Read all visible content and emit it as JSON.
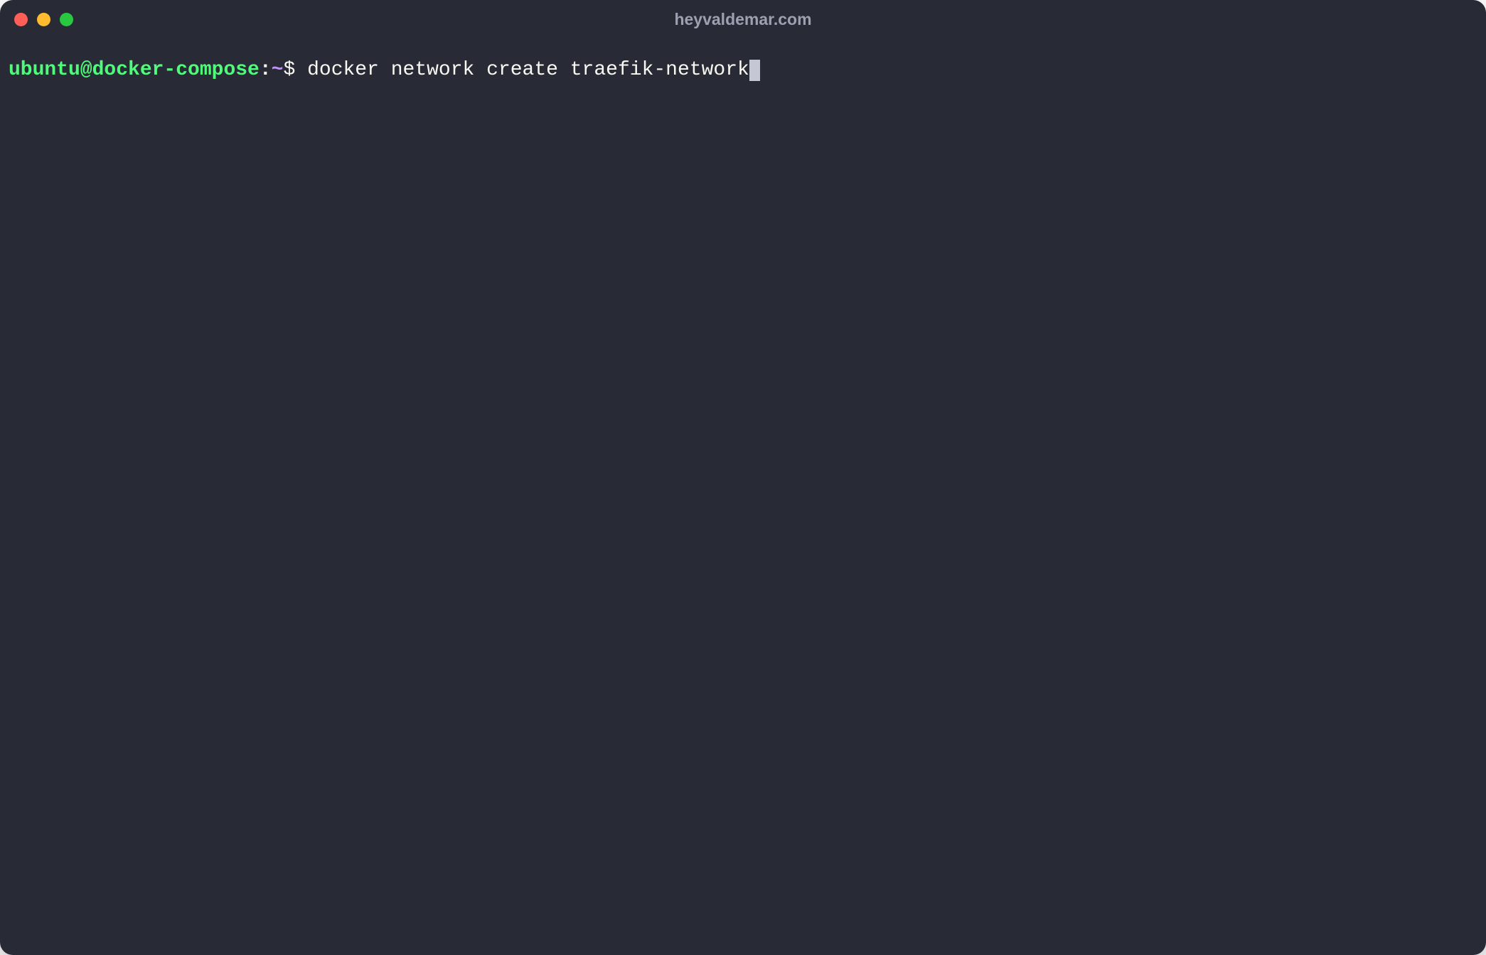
{
  "window": {
    "title": "heyvaldemar.com"
  },
  "prompt": {
    "user_host": "ubuntu@docker-compose",
    "colon": ":",
    "path": "~",
    "dollar": "$ "
  },
  "command": {
    "text": "docker network create traefik-network"
  }
}
